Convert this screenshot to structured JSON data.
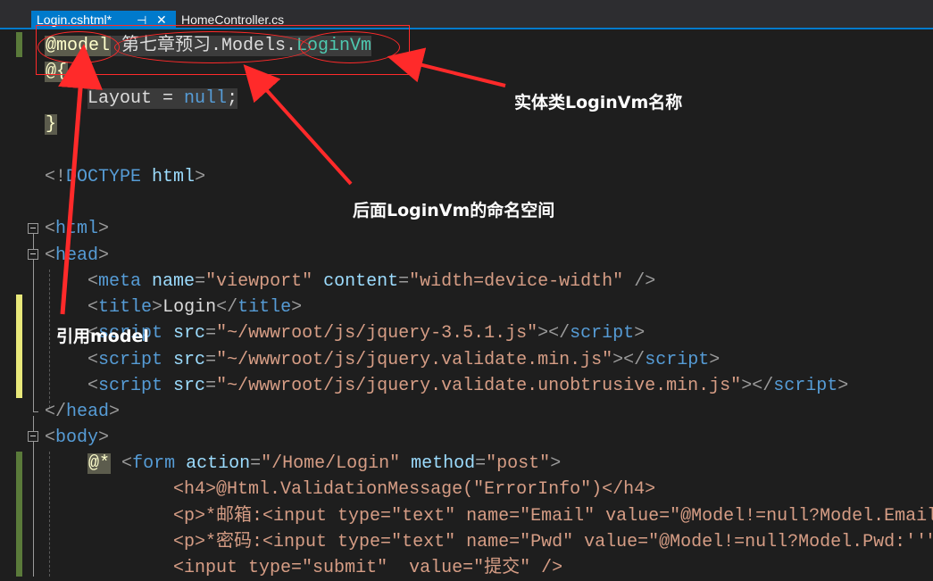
{
  "tabs": [
    {
      "label": "Login.cshtml*",
      "pin_icon": "⊣",
      "close_icon": "✕",
      "active": true
    },
    {
      "label": "HomeController.cs",
      "active": false
    }
  ],
  "code": {
    "line1": {
      "razor_kw": "@model",
      "sp": " ",
      "ns": "第七章预习.Models.",
      "type": "LoginVm"
    },
    "line2": {
      "open": "@{"
    },
    "line3": {
      "indent": "    ",
      "code": "Layout = ",
      "kw": "null",
      "semi": ";"
    },
    "line4": {
      "close": "}"
    },
    "line6": {
      "lt": "<!",
      "kw": "DOCTYPE",
      "sp": " ",
      "name": "html",
      "gt": ">"
    },
    "line7": {
      "lt": "<",
      "tag": "html",
      "gt": ">"
    },
    "line8": {
      "lt": "<",
      "tag": "head",
      "gt": ">"
    },
    "line9": {
      "indent": "    ",
      "lt": "<",
      "tag": "meta",
      "a1": " name",
      "eq1": "=",
      "v1": "\"viewport\"",
      "a2": " content",
      "eq2": "=",
      "v2": "\"width=device-width\"",
      "end": " />"
    },
    "line10": {
      "indent": "    ",
      "lt": "<",
      "tag": "title",
      "gt": ">",
      "text": "Login",
      "lt2": "</",
      "tag2": "title",
      "gt2": ">"
    },
    "line11": {
      "indent": "    ",
      "lt": "<",
      "tag": "script",
      "a1": " src",
      "eq1": "=",
      "v1": "\"~/wwwroot/js/jquery-3.5.1.js\"",
      "gt": ">",
      "lt2": "</",
      "tag2": "script",
      "gt2": ">"
    },
    "line12": {
      "indent": "    ",
      "lt": "<",
      "tag": "script",
      "a1": " src",
      "eq1": "=",
      "v1": "\"~/wwwroot/js/jquery.validate.min.js\"",
      "gt": ">",
      "lt2": "</",
      "tag2": "script",
      "gt2": ">"
    },
    "line13": {
      "indent": "    ",
      "lt": "<",
      "tag": "script",
      "a1": " src",
      "eq1": "=",
      "v1": "\"~/wwwroot/js/jquery.validate.unobtrusive.min.js\"",
      "gt": ">",
      "lt2": "</",
      "tag2": "script",
      "gt2": ">"
    },
    "line14": {
      "lt": "</",
      "tag": "head",
      "gt": ">"
    },
    "line15": {
      "lt": "<",
      "tag": "body",
      "gt": ">"
    },
    "line16": {
      "indent": "    ",
      "razor": "@*",
      "sp": " ",
      "lt": "<",
      "tag": "form",
      "a1": " action",
      "eq1": "=",
      "v1": "\"/Home/Login\"",
      "a2": " method",
      "eq2": "=",
      "v2": "\"post\"",
      "gt": ">"
    },
    "line17": {
      "indent": "            ",
      "text": "<h4>@Html.ValidationMessage(\"ErrorInfo\")</h4>"
    },
    "line18": {
      "indent": "            ",
      "text": "<p>*邮箱:<input type=\"text\" name=\"Email\" value=\"@Model!=null?Model.Email"
    },
    "line19": {
      "indent": "            ",
      "text": "<p>*密码:<input type=\"text\" name=\"Pwd\" value=\"@Model!=null?Model.Pwd:''\""
    },
    "line20": {
      "indent": "            ",
      "text": "<input type=\"submit\"  value=\"提交\" />"
    }
  },
  "annotations": {
    "entity_name": "实体类LoginVm名称",
    "namespace_note": "后面LoginVm的命名空间",
    "model_ref": "引用model"
  },
  "colors": {
    "background": "#1e1e1e",
    "tab_active": "#007acc",
    "annotation_red": "#ff2a2a",
    "change_saved": "#5a7a3a",
    "change_unsaved": "#e8e87a"
  }
}
